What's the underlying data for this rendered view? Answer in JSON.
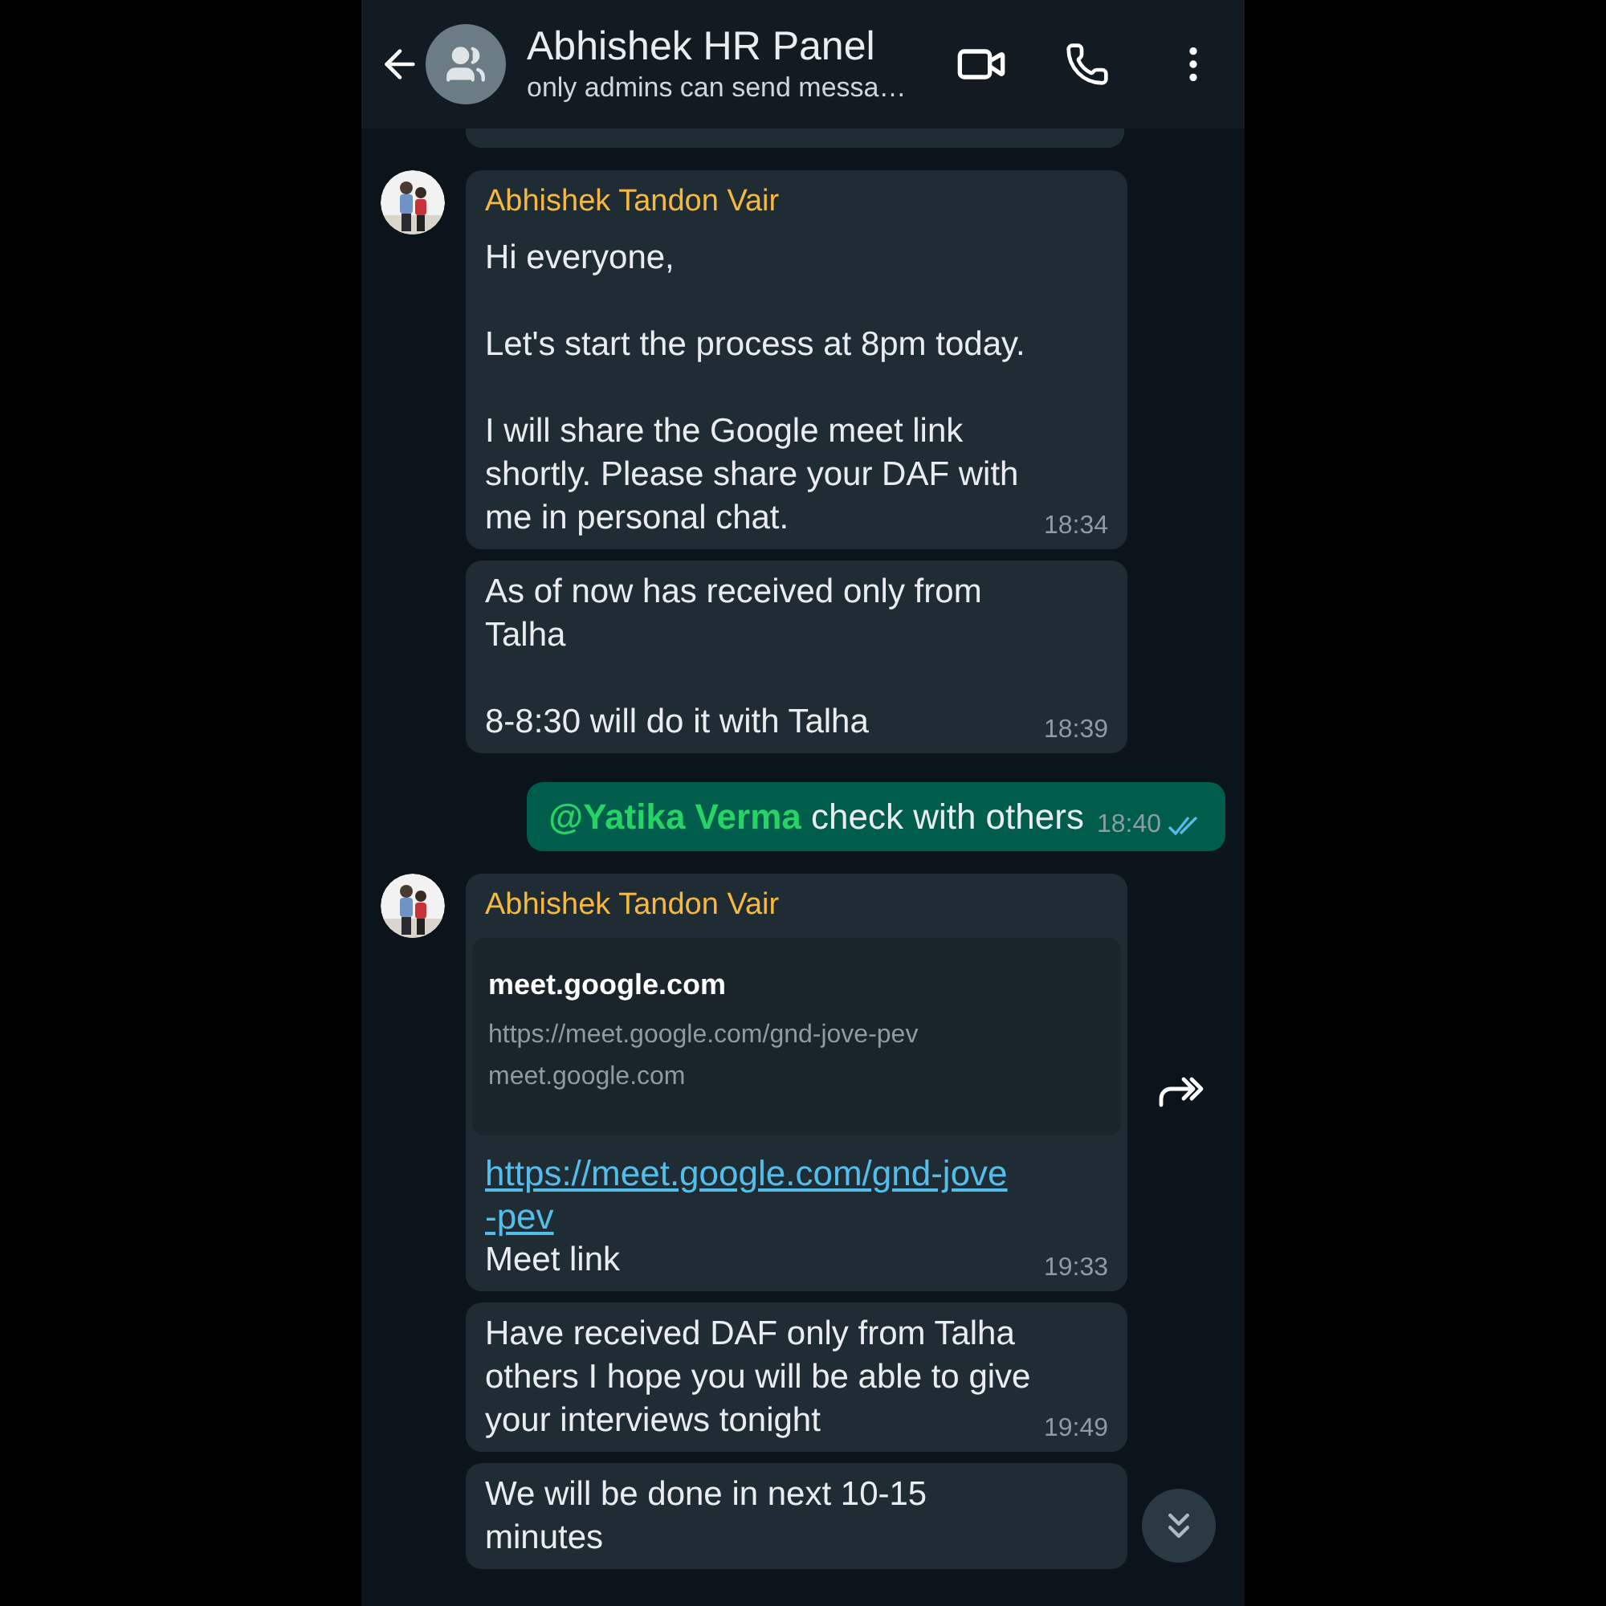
{
  "header": {
    "title": "Abhishek HR Panel",
    "subtitle": "only admins can send messa…"
  },
  "messages": [
    {
      "kind": "incoming",
      "sender": "Abhishek Tandon Vair",
      "text": "Hi everyone,\n\nLet's start the process at 8pm today.\n\nI will share the Google meet link\nshortly. Please share your DAF with\nme in personal chat.",
      "time": "18:34"
    },
    {
      "kind": "incoming",
      "text": "As of now has received only from\nTalha\n\n8-8:30 will do it with Talha",
      "time": "18:39"
    },
    {
      "kind": "outgoing",
      "text": "**@Yatika Verma** check with others",
      "time": "18:40",
      "read": true
    },
    {
      "kind": "link",
      "sender": "Abhishek Tandon Vair",
      "preview": {
        "title": "meet.google.com",
        "url": "https://meet.google.com/gnd-jove-pev",
        "domain": "meet.google.com"
      },
      "link": "https://meet.google.com/gnd-jove\n-pev",
      "text": "Meet link",
      "time": "19:33"
    },
    {
      "kind": "incoming",
      "text": "Have received DAF only from Talha\nothers I hope you will be able to give\nyour interviews tonight",
      "time": "19:49"
    },
    {
      "kind": "incoming",
      "text": "We will be done in next 10-15\nminutes"
    }
  ]
}
